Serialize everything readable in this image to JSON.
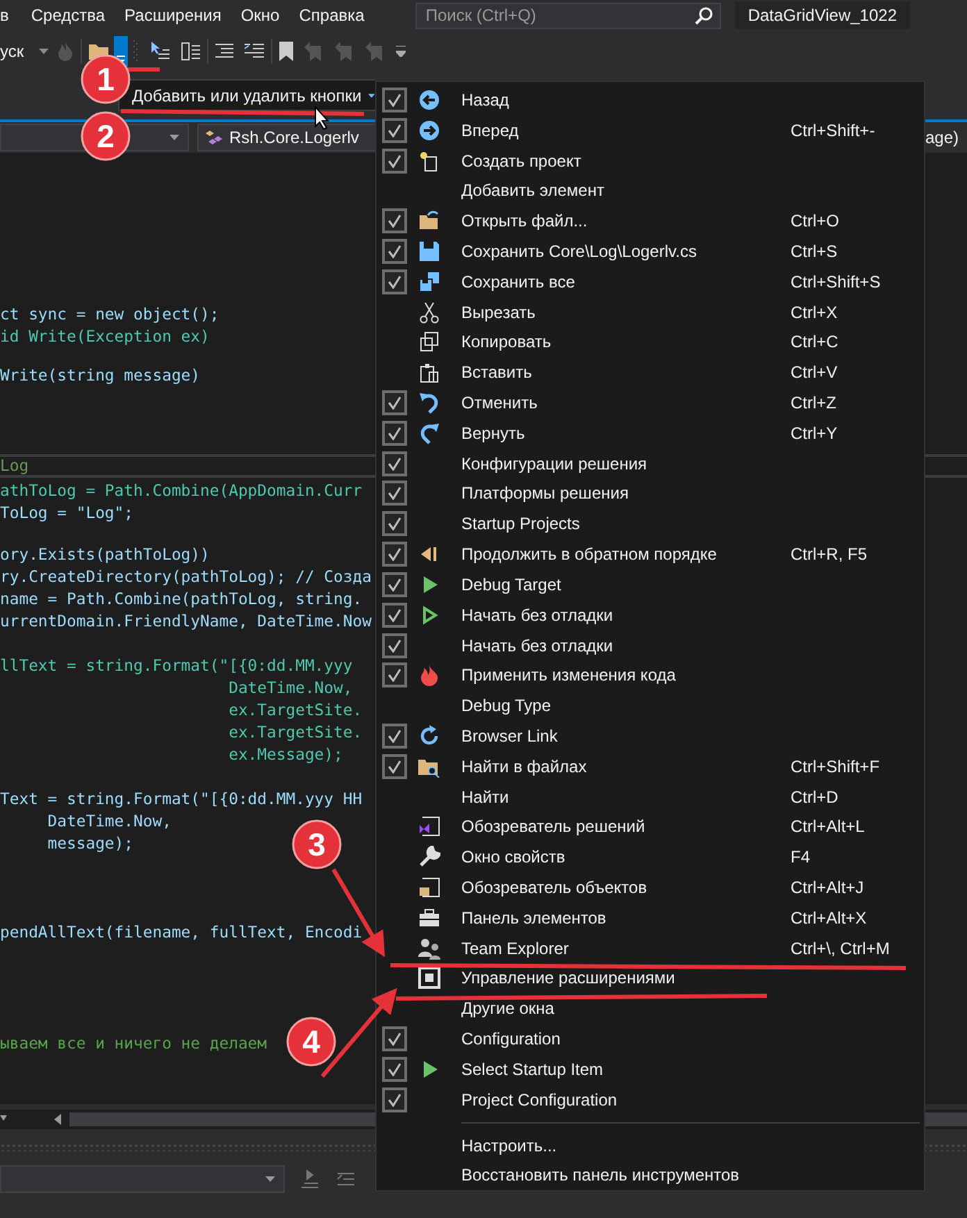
{
  "menu_bar": {
    "items": [
      "в",
      "Средства",
      "Расширения",
      "Окно",
      "Справка"
    ],
    "search": {
      "placeholder": "Поиск (Ctrl+Q)"
    },
    "solution_name": "DataGridView_1022"
  },
  "toolbar": {
    "start_label": "уск"
  },
  "navigation_bar": {
    "member_dropdown": "Rsh.Core.Logerlv",
    "right_dropdown": "age)"
  },
  "editor": {
    "lines": [
      {
        "text": "ct sync = new object();",
        "kind": "code"
      },
      {
        "text": "id Write(Exception ex)",
        "kind": "member"
      },
      {
        "text": "Write(string message)",
        "kind": "code"
      },
      {
        "text": "Log",
        "kind": "region"
      },
      {
        "text": "athToLog = Path.Combine(AppDomain.Curr",
        "kind": "member"
      },
      {
        "text": "ToLog = \"Log\";",
        "kind": "code"
      },
      {
        "text": "ory.Exists(pathToLog))",
        "kind": "code"
      },
      {
        "text": "ry.CreateDirectory(pathToLog); // Созда",
        "kind": "code"
      },
      {
        "text": "name = Path.Combine(pathToLog, string.",
        "kind": "code"
      },
      {
        "text": "urrentDomain.FriendlyName, DateTime.Now",
        "kind": "code"
      },
      {
        "text": "llText = string.Format(\"[{0:dd.MM.yyy",
        "kind": "member"
      },
      {
        "text": "                        DateTime.Now,",
        "kind": "member"
      },
      {
        "text": "                        ex.TargetSite.",
        "kind": "member"
      },
      {
        "text": "                        ex.TargetSite.",
        "kind": "member"
      },
      {
        "text": "                        ex.Message);",
        "kind": "member"
      },
      {
        "text": "Text = string.Format(\"[{0:dd.MM.yyy HH",
        "kind": "code"
      },
      {
        "text": "     DateTime.Now,",
        "kind": "code"
      },
      {
        "text": "     message);",
        "kind": "code"
      },
      {
        "text": "pendAllText(filename, fullText, Encodi",
        "kind": "code"
      },
      {
        "text": "ываем все и ничего не делаем",
        "kind": "comment"
      }
    ]
  },
  "popup": {
    "header": "Добавить или удалить кнопки",
    "toggle_items": [
      {
        "label": "Назад",
        "checked": true
      },
      {
        "label": "Вперед",
        "shortcut": "Ctrl+Shift+-",
        "checked": true
      },
      {
        "label": "Создать проект",
        "checked": true
      },
      {
        "label": "Добавить элемент",
        "checked": false
      },
      {
        "label": "Открыть файл...",
        "shortcut": "Ctrl+O",
        "checked": true
      },
      {
        "label": "Сохранить Core\\Log\\Logerlv.cs",
        "shortcut": "Ctrl+S",
        "checked": true
      },
      {
        "label": "Сохранить все",
        "shortcut": "Ctrl+Shift+S",
        "checked": true
      },
      {
        "label": "Вырезать",
        "shortcut": "Ctrl+X",
        "checked": false
      },
      {
        "label": "Копировать",
        "shortcut": "Ctrl+C",
        "checked": false
      },
      {
        "label": "Вставить",
        "shortcut": "Ctrl+V",
        "checked": false
      },
      {
        "label": "Отменить",
        "shortcut": "Ctrl+Z",
        "checked": true
      },
      {
        "label": "Вернуть",
        "shortcut": "Ctrl+Y",
        "checked": true
      },
      {
        "label": "Конфигурации решения",
        "checked": true
      },
      {
        "label": "Платформы решения",
        "checked": true
      },
      {
        "label": "Startup Projects",
        "checked": true
      },
      {
        "label": "Продолжить в обратном порядке",
        "shortcut": "Ctrl+R, F5",
        "checked": true
      },
      {
        "label": "Debug Target",
        "checked": true
      },
      {
        "label": "Начать без отладки",
        "checked": true
      },
      {
        "label": "Начать без отладки",
        "checked": true
      },
      {
        "label": "Применить изменения кода",
        "checked": true
      },
      {
        "label": "Debug Type",
        "checked": false
      },
      {
        "label": "Browser Link",
        "checked": true
      },
      {
        "label": "Найти в файлах",
        "shortcut": "Ctrl+Shift+F",
        "checked": true
      },
      {
        "label": "Найти",
        "shortcut": "Ctrl+D",
        "checked": false
      },
      {
        "label": "Обозреватель решений",
        "shortcut": "Ctrl+Alt+L",
        "checked": false
      },
      {
        "label": "Окно свойств",
        "shortcut": "F4",
        "checked": false
      },
      {
        "label": "Обозреватель объектов",
        "shortcut": "Ctrl+Alt+J",
        "checked": false
      },
      {
        "label": "Панель элементов",
        "shortcut": "Ctrl+Alt+X",
        "checked": false
      },
      {
        "label": "Team Explorer",
        "shortcut": "Ctrl+\\, Ctrl+M",
        "checked": false
      },
      {
        "label": "Управление расширениями",
        "checked": false
      },
      {
        "label": "Другие окна",
        "checked": false
      },
      {
        "label": "Configuration",
        "checked": true
      },
      {
        "label": "Select Startup Item",
        "checked": true
      },
      {
        "label": "Project Configuration",
        "checked": true
      }
    ],
    "actions": [
      "Настроить...",
      "Восстановить панель инструментов"
    ]
  },
  "annotations": [
    {
      "label": "1"
    },
    {
      "label": "2"
    },
    {
      "label": "3"
    },
    {
      "label": "4"
    }
  ]
}
